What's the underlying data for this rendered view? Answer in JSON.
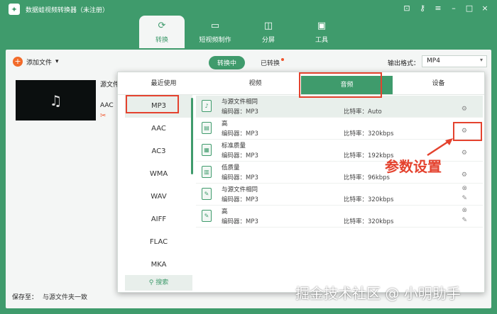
{
  "window": {
    "title": "数据蛙视频转换器（未注册）"
  },
  "nav_tabs": [
    {
      "label": "转换",
      "icon": "convert-icon"
    },
    {
      "label": "短视频制作",
      "icon": "short-video-icon"
    },
    {
      "label": "分屏",
      "icon": "split-screen-icon"
    },
    {
      "label": "工具",
      "icon": "toolbox-icon"
    }
  ],
  "toolbar": {
    "add_file": "添加文件",
    "converting": "转换中",
    "converted": "已转换",
    "output_format_label": "输出格式：",
    "output_format_value": "MP4"
  },
  "file": {
    "source_label": "源文件",
    "codec": "AAC"
  },
  "footer": {
    "save_to_label": "保存至：",
    "save_to_value": "与源文件夹一致"
  },
  "panel": {
    "tabs": [
      "最近使用",
      "视频",
      "音频",
      "设备"
    ],
    "active_tab_index": 2,
    "formats": [
      "MP3",
      "AAC",
      "AC3",
      "WMA",
      "WAV",
      "AIFF",
      "FLAC",
      "MKA"
    ],
    "selected_format": "MP3",
    "search_label": "搜索",
    "rows": [
      {
        "name": "与源文件相同",
        "encoder": "编码器：MP3",
        "bitrate": "比特率：Auto",
        "action": "gear-icon"
      },
      {
        "name": "高",
        "encoder": "编码器：MP3",
        "bitrate": "比特率：320kbps",
        "action": "gear-icon"
      },
      {
        "name": "标准质量",
        "encoder": "编码器：MP3",
        "bitrate": "比特率：192kbps",
        "action": "gear-icon"
      },
      {
        "name": "低质量",
        "encoder": "编码器：MP3",
        "bitrate": "比特率：96kbps",
        "action": "gear-icon"
      },
      {
        "name": "与源文件相同",
        "encoder": "编码器：MP3",
        "bitrate": "比特率：320kbps",
        "action": "edit-icon"
      },
      {
        "name": "高",
        "encoder": "编码器：MP3",
        "bitrate": "比特率：320kbps",
        "action": "edit-icon"
      }
    ]
  },
  "annotation": {
    "text": "参数设置"
  },
  "watermark": "掘金技术社区 @ 小明助手",
  "colors": {
    "brand": "#3f9b6c",
    "highlight": "#e4422e",
    "accent": "#f26b2a"
  }
}
